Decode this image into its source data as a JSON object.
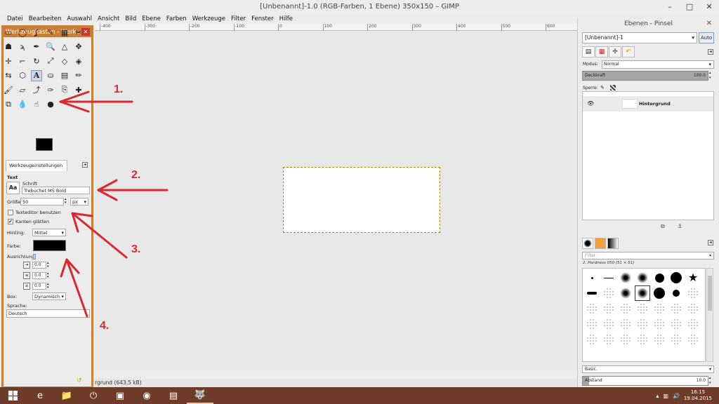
{
  "window": {
    "title": "[Unbenannt]-1.0 (RGB-Farben, 1 Ebene) 350x150 – GIMP",
    "controls": [
      "–",
      "□",
      "✕"
    ]
  },
  "menu": [
    "Datei",
    "Bearbeiten",
    "Auswahl",
    "Ansicht",
    "Bild",
    "Ebene",
    "Farben",
    "Werkzeuge",
    "Filter",
    "Fenster",
    "Hilfe"
  ],
  "ruler": {
    "labels": [
      "-400",
      "-300",
      "-200",
      "-100",
      "0",
      "100",
      "200",
      "300",
      "400",
      "500",
      "600"
    ]
  },
  "status": {
    "text": "rgrund (643,5 kB)"
  },
  "toolbox": {
    "title": "Werkzeugkasten - Werk...",
    "tools": [
      {
        "name": "rect-select",
        "glyph": "▭"
      },
      {
        "name": "ellipse-select",
        "glyph": "◯"
      },
      {
        "name": "free-select",
        "glyph": "ʆ"
      },
      {
        "name": "fuzzy-select",
        "glyph": "✎"
      },
      {
        "name": "color-select",
        "glyph": "▦"
      },
      {
        "name": "scissors",
        "glyph": "✂"
      },
      {
        "name": "foreground-select",
        "glyph": "☗"
      },
      {
        "name": "paths",
        "glyph": "ϡ"
      },
      {
        "name": "color-picker",
        "glyph": "✒"
      },
      {
        "name": "zoom",
        "glyph": "🔍"
      },
      {
        "name": "measure",
        "glyph": "△"
      },
      {
        "name": "move",
        "glyph": "✥"
      },
      {
        "name": "align",
        "glyph": "✛"
      },
      {
        "name": "crop",
        "glyph": "⌐"
      },
      {
        "name": "rotate",
        "glyph": "↻"
      },
      {
        "name": "scale",
        "glyph": "⤢"
      },
      {
        "name": "shear",
        "glyph": "◇"
      },
      {
        "name": "perspective",
        "glyph": "◈"
      },
      {
        "name": "flip",
        "glyph": "⇆"
      },
      {
        "name": "cage",
        "glyph": "⬡"
      },
      {
        "name": "text",
        "glyph": "A"
      },
      {
        "name": "bucket-fill",
        "glyph": "⛀"
      },
      {
        "name": "blend",
        "glyph": "▤"
      },
      {
        "name": "pencil",
        "glyph": "✏"
      },
      {
        "name": "paintbrush",
        "glyph": "🖌"
      },
      {
        "name": "eraser",
        "glyph": "▱"
      },
      {
        "name": "airbrush",
        "glyph": "⤴"
      },
      {
        "name": "ink",
        "glyph": "✑"
      },
      {
        "name": "clone",
        "glyph": "⎘"
      },
      {
        "name": "heal",
        "glyph": "✚"
      },
      {
        "name": "perspective-clone",
        "glyph": "⧉"
      },
      {
        "name": "blur",
        "glyph": "💧"
      },
      {
        "name": "smudge",
        "glyph": "☝"
      },
      {
        "name": "dodge-burn",
        "glyph": "●"
      }
    ],
    "active_tool": "text",
    "options_tab": "Werkzeugeinstellungen",
    "options": {
      "heading": "Text",
      "font_label": "Schrift",
      "font_value": "Trebuchet MS Bold",
      "aa_icon": "Aa",
      "size_label": "Größe:",
      "size_value": "50",
      "unit": "px",
      "use_editor": "Texteditor benutzen",
      "antialias": "Kanten glätten",
      "hinting_label": "Hinting:",
      "hinting_value": "Mittel",
      "color_label": "Farbe:",
      "justify_label": "Ausrichtung:",
      "indent": "0.0",
      "line_spacing": "0.0",
      "letter_spacing": "0.0",
      "box_label": "Box:",
      "box_value": "Dynamisch",
      "lang_label": "Sprache:",
      "lang_value": "Deutsch"
    }
  },
  "dock": {
    "title": "Ebenen - Pinsel",
    "image": "[Unbenannt]-1",
    "auto": "Auto",
    "mode_label": "Modus:",
    "mode_value": "Normal",
    "opacity_label": "Deckkraft",
    "opacity_value": "100.0",
    "lock_label": "Sperre:",
    "layer_name": "Hintergrund",
    "filter_placeholder": "Filter",
    "brush_name": "2. Hardness 050 (51 × 51)",
    "preset": "Basic.",
    "spacing_label": "Abstand",
    "spacing_value": "10.0",
    "spacing_fraction": 0.05
  },
  "annotations": [
    "1.",
    "2.",
    "3.",
    "4."
  ],
  "taskbar": {
    "apps": [
      {
        "name": "internet-explorer",
        "glyph": "e"
      },
      {
        "name": "file-explorer",
        "glyph": "📁"
      },
      {
        "name": "shutdown",
        "glyph": "⏻"
      },
      {
        "name": "desktop-app",
        "glyph": "▣"
      },
      {
        "name": "chrome",
        "glyph": "◉"
      },
      {
        "name": "store",
        "glyph": "▤"
      },
      {
        "name": "gimp",
        "glyph": "🐺"
      }
    ],
    "time": "16:15",
    "date": "19.04.2015"
  }
}
